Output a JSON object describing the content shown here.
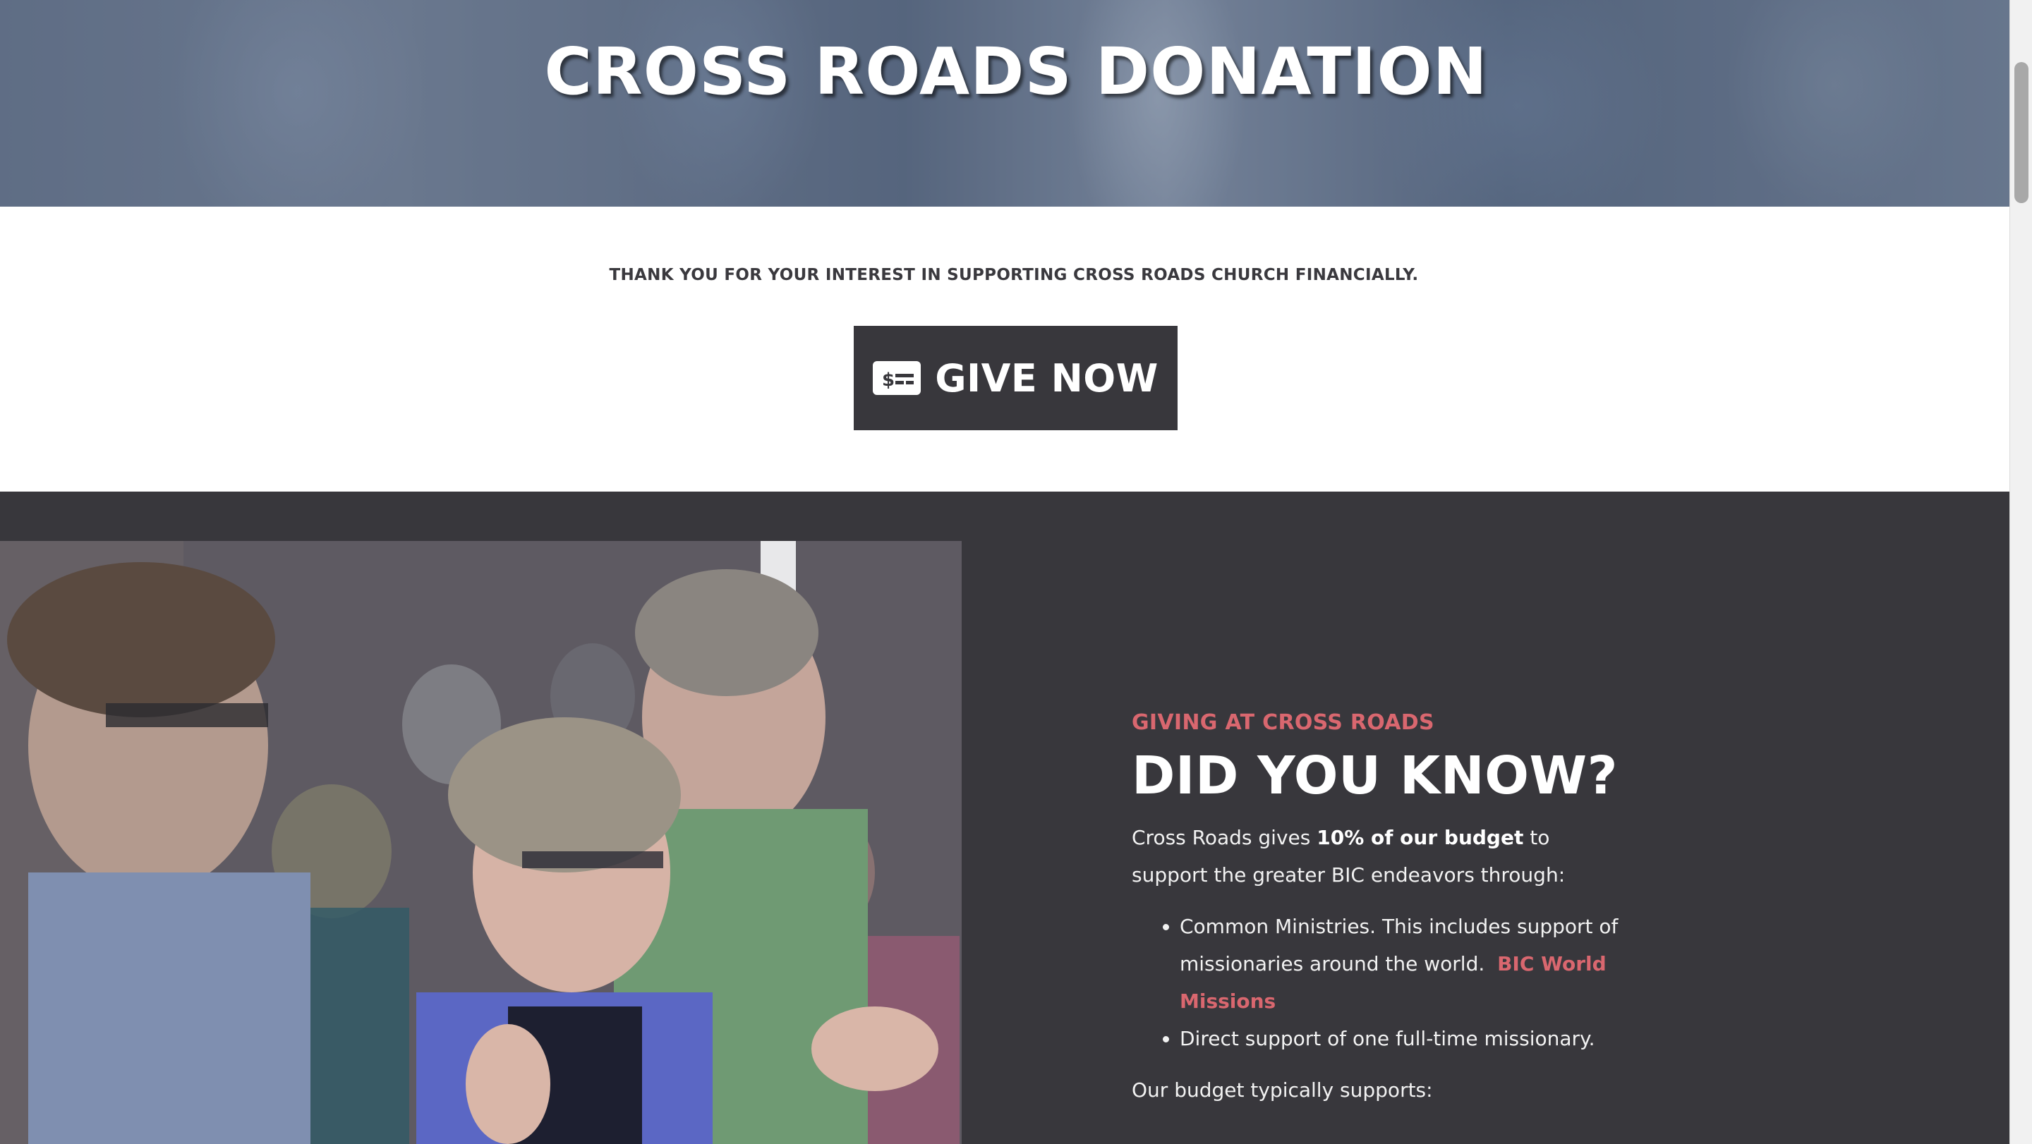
{
  "hero": {
    "title": "CROSS ROADS DONATION"
  },
  "intro": {
    "text": "THANK YOU FOR YOUR INTEREST IN SUPPORTING CROSS ROADS CHURCH FINANCIALLY.",
    "give_button_label": "GIVE NOW",
    "give_button_icon": "money-check-icon"
  },
  "info": {
    "eyebrow": "GIVING AT CROSS ROADS",
    "heading": "DID YOU KNOW?",
    "para_before_bold": "Cross Roads gives ",
    "para_bold": "10% of our budget",
    "para_after_bold": " to support the greater BIC endeavors through:",
    "bullets": [
      {
        "text": "Common Ministries. This includes support of missionaries around the world.",
        "link_label": "BIC World Missions"
      },
      {
        "text": "Direct support of one full-time missionary."
      }
    ],
    "budget_text": "Our budget typically supports:"
  },
  "colors": {
    "dark_background": "#38373c",
    "accent": "#d9676f",
    "white": "#ffffff"
  }
}
